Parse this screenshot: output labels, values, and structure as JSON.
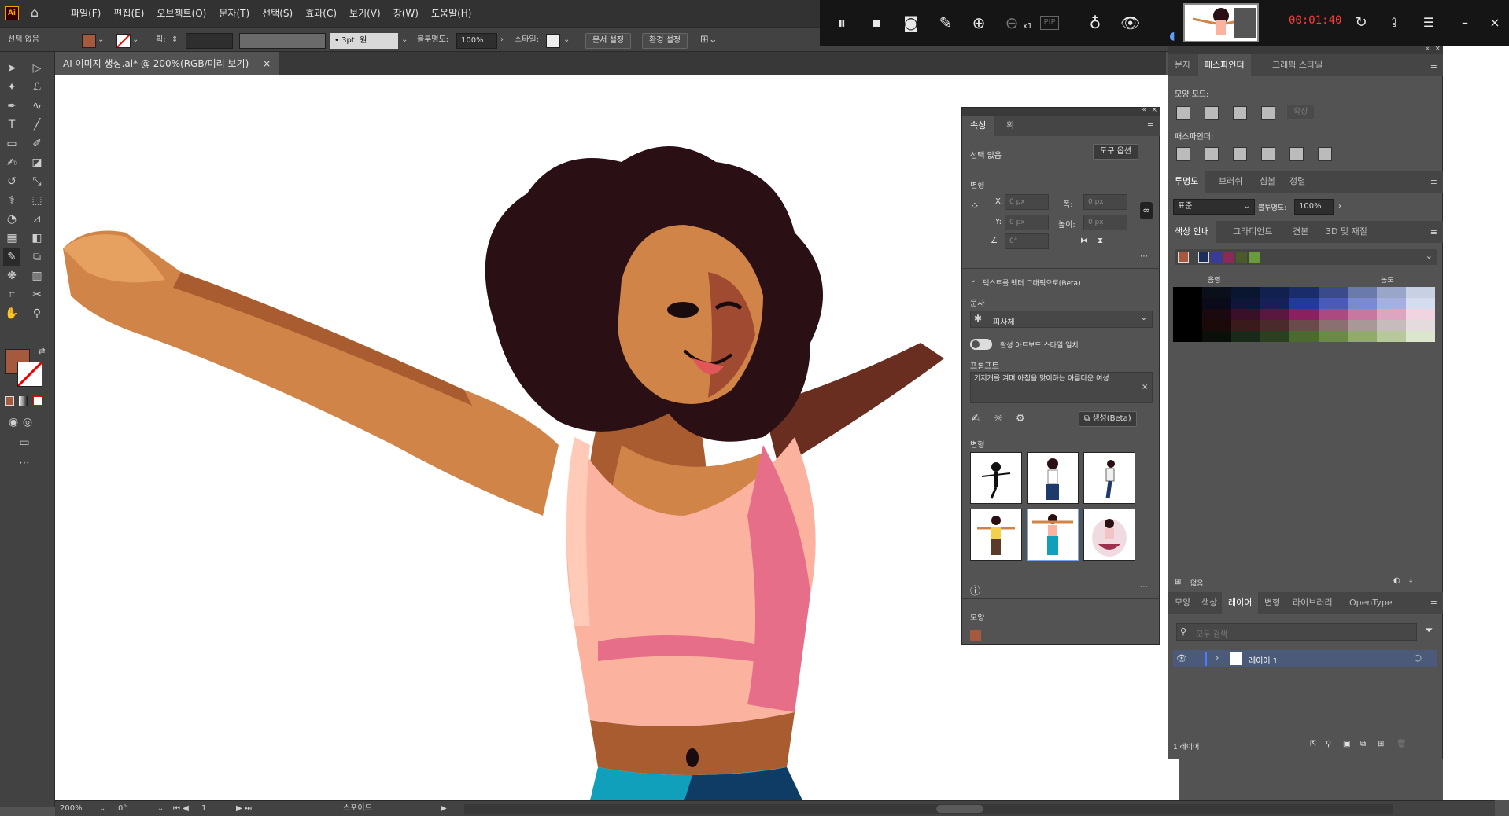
{
  "app": {
    "logo": "Ai"
  },
  "menu": [
    "파일(F)",
    "편집(E)",
    "오브젝트(O)",
    "문자(T)",
    "선택(S)",
    "효과(C)",
    "보기(V)",
    "창(W)",
    "도움말(H)"
  ],
  "control": {
    "selection": "선택 없음",
    "stroke_label": "획:",
    "brush": "3pt. 원",
    "opacity_label": "불투명도:",
    "opacity": "100%",
    "style_label": "스타일:",
    "doc_setup": "문서 설정",
    "prefs": "환경 설정"
  },
  "recorder": {
    "time": "00:01:40",
    "zoom_hint": "x1",
    "pip": "PIP"
  },
  "doc_tab": {
    "title": "AI 이미지 생성.ai* @ 200%(RGB/미리 보기)"
  },
  "properties": {
    "tabs": [
      "속성",
      "획"
    ],
    "selection": "선택 없음",
    "tool_options": "도구 옵션",
    "transform": "변형",
    "x_label": "X:",
    "y_label": "Y:",
    "w_label": "폭:",
    "h_label": "높이:",
    "x": "0 px",
    "y": "0 px",
    "w": "0 px",
    "h": "0 px",
    "angle": "0°",
    "text_to_vector": "텍스트를 벡터 그래픽으로(Beta)",
    "type_label": "문자",
    "type_value": "피사체",
    "match_style": "활성 아트보드 스타일 일치",
    "prompt_label": "프롬프트",
    "prompt": "기지개를 켜며 아침을 맞이하는 아름다운 여성",
    "generate": "생성(Beta)",
    "variations": "변형",
    "appearance": "모양"
  },
  "dock": {
    "tabs1": [
      "문자",
      "패스파인더",
      "그래픽 스타일"
    ],
    "shape_modes": "모양 모드:",
    "expand": "확장",
    "pathfinders": "패스파인더:",
    "tabs2": [
      "투명도",
      "브러쉬",
      "심볼",
      "정렬"
    ],
    "blend": "표준",
    "opacity_label": "불투명도:",
    "opacity": "100%",
    "tabs3": [
      "색상 안내",
      "그라디언트",
      "견본",
      "3D 및 재질"
    ],
    "shade": "음영",
    "tint": "농도",
    "none": "없음",
    "tabs4": [
      "모양",
      "색상",
      "레이어",
      "변형",
      "라이브러리",
      "OpenType"
    ],
    "search_placeholder": "모두 검색",
    "layer": "레이어 1",
    "layer_count": "1 레이어"
  },
  "status": {
    "zoom": "200%",
    "rotate": "0°",
    "artboard": "1",
    "tool": "스포이드"
  },
  "colors": {
    "fill": "#a55a3e",
    "hair": "#2a1014",
    "skin": "#d08448",
    "skin_light": "#e6a060",
    "skin_shadow": "#a85c30",
    "top": "#fbb3a0",
    "top_shadow": "#e76e88",
    "jeans": "#10a0bc",
    "jeans_dark": "#0e3c64"
  }
}
